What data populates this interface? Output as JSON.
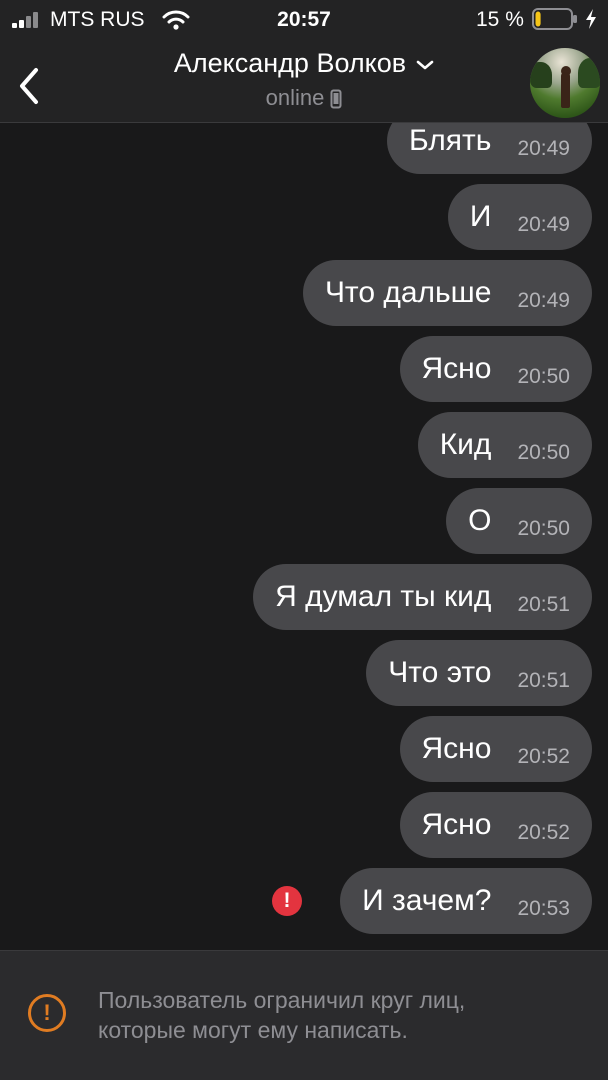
{
  "status_bar": {
    "carrier": "MTS RUS",
    "time": "20:57",
    "battery_percent_label": "15 %",
    "battery_level": 0.15,
    "battery_color": "#f5c518"
  },
  "header": {
    "back_icon": "chevron-left-icon",
    "contact_name": "Александр Волков",
    "status": "online",
    "status_device_icon": "mobile-phone-icon",
    "expand_icon": "chevron-down-icon"
  },
  "messages": [
    {
      "text": "Блять",
      "time": "20:49",
      "failed": false
    },
    {
      "text": "И",
      "time": "20:49",
      "failed": false
    },
    {
      "text": "Что дальше",
      "time": "20:49",
      "failed": false
    },
    {
      "text": "Ясно",
      "time": "20:50",
      "failed": false
    },
    {
      "text": "Кид",
      "time": "20:50",
      "failed": false
    },
    {
      "text": "О",
      "time": "20:50",
      "failed": false
    },
    {
      "text": "Я думал ты кид",
      "time": "20:51",
      "failed": false
    },
    {
      "text": "Что это",
      "time": "20:51",
      "failed": false
    },
    {
      "text": "Ясно",
      "time": "20:52",
      "failed": false
    },
    {
      "text": "Ясно",
      "time": "20:52",
      "failed": false
    },
    {
      "text": "И зачем?",
      "time": "20:53",
      "failed": true
    }
  ],
  "error_icon": {
    "symbol": "!",
    "color": "#e3343f"
  },
  "notice": {
    "icon_symbol": "!",
    "icon_color": "#e07c22",
    "text": "Пользователь ограничил круг лиц,\nкоторые могут ему написать."
  }
}
